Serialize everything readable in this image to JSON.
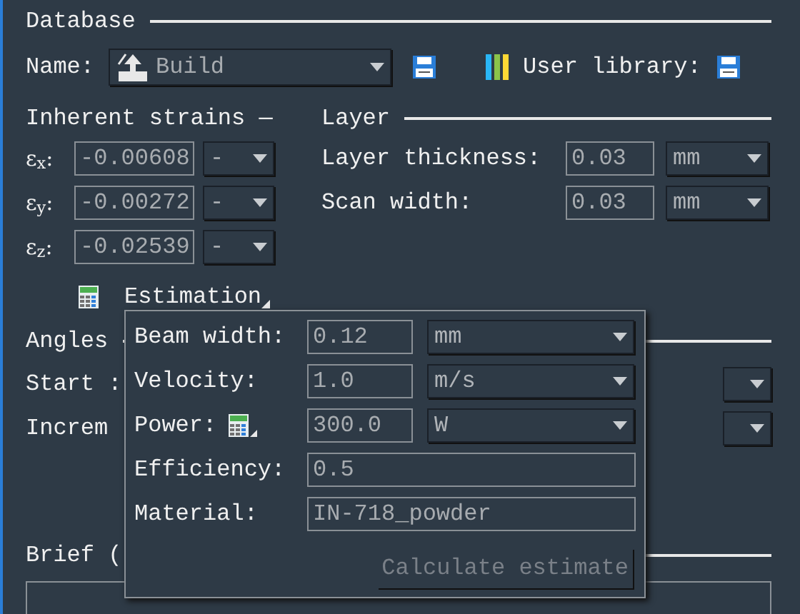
{
  "database": {
    "title": "Database",
    "name_label": "Name:",
    "name_value": "Build",
    "user_library_label": "User library:"
  },
  "inherent_strains": {
    "title": "Inherent strains —",
    "rows": [
      {
        "label": "ε$_{x}$:",
        "value": "-0.00608",
        "unit": "-"
      },
      {
        "label": "ε$_{y}$:",
        "value": "-0.00272",
        "unit": "-"
      },
      {
        "label": "ε$_{z}$:",
        "value": "-0.02539",
        "unit": "-"
      }
    ]
  },
  "layer": {
    "title": "Layer",
    "rows": [
      {
        "label": "Layer thickness:",
        "value": "0.03",
        "unit": "mm"
      },
      {
        "label": "Scan width:",
        "value": "0.03",
        "unit": "mm"
      }
    ]
  },
  "estimation": {
    "label": "Estimation",
    "popup": {
      "rows": [
        {
          "kind": "unit",
          "label": "Beam width:",
          "value": "0.12",
          "unit": "mm"
        },
        {
          "kind": "unit",
          "label": "Velocity:",
          "value": "1.0",
          "unit": "m/s"
        },
        {
          "kind": "calc",
          "label": "Power:",
          "value": "300.0",
          "unit": "W"
        },
        {
          "kind": "text",
          "label": "Efficiency:",
          "value": "0.5"
        },
        {
          "kind": "text",
          "label": "Material:",
          "value": "IN-718_powder"
        }
      ],
      "button": {
        "label": "Calculate estimate",
        "disabled": true
      }
    }
  },
  "angles": {
    "title": "Angles",
    "rows": [
      {
        "label": "Start :"
      },
      {
        "label": "Increm"
      }
    ]
  },
  "brief": {
    "title": "Brief ("
  }
}
